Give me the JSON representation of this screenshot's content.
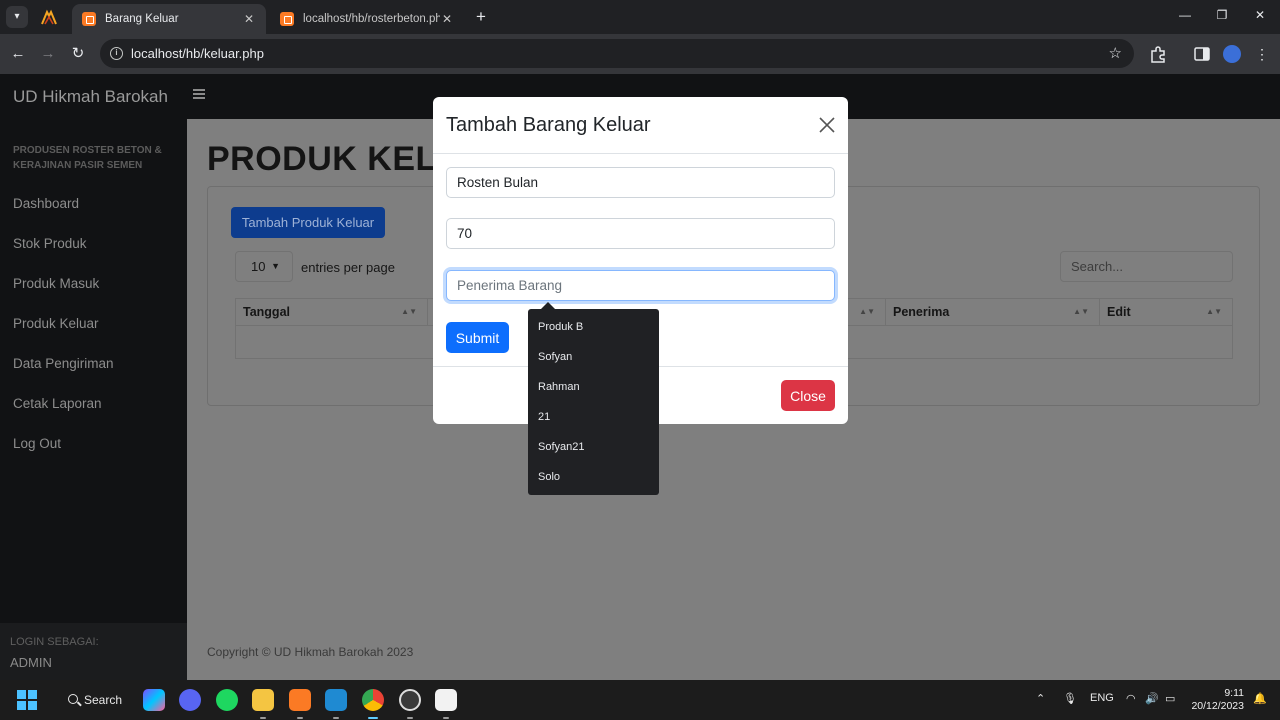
{
  "browser": {
    "tabs": [
      {
        "title": "Barang Keluar",
        "close_glyph": "✕"
      },
      {
        "title": "localhost/hb/rosterbeton.php",
        "close_glyph": "✕"
      }
    ],
    "new_tab_glyph": "+",
    "url": "localhost/hb/keluar.php",
    "window_controls": [
      "—",
      "❐",
      "✕"
    ]
  },
  "app": {
    "brand": "UD Hikmah Barokah",
    "sidebar_heading": "PRODUSEN ROSTER BETON & KERAJINAN PASIR SEMEN",
    "nav": [
      "Dashboard",
      "Stok Produk",
      "Produk Masuk",
      "Produk Keluar",
      "Data Pengiriman",
      "Cetak Laporan",
      "Log Out"
    ],
    "login_label": "LOGIN SEBAGAI:",
    "login_user": "ADMIN",
    "page_title": "PRODUK KELUAR",
    "add_button": "Tambah Produk Keluar",
    "entries_value": "10",
    "entries_label": "entries per page",
    "search_placeholder": "Search...",
    "table_headers": [
      "Tanggal",
      "Penerima",
      "Edit"
    ],
    "copyright": "Copyright © UD Hikmah Barokah 2023"
  },
  "modal": {
    "title": "Tambah Barang Keluar",
    "product_value": "Rosten Bulan",
    "qty_value": "70",
    "receiver_placeholder": "Penerima Barang",
    "submit_label": "Submit",
    "close_label": "Close"
  },
  "autocomplete": [
    "Produk B",
    "Sofyan",
    "Rahman",
    "21",
    "Sofyan21",
    "Solo"
  ],
  "taskbar": {
    "search_label": "Search",
    "language": "ENG",
    "time": "9:11",
    "date": "20/12/2023"
  },
  "colors": {
    "primary": "#0d6efd",
    "danger": "#dc3545",
    "sidebar": "#111214",
    "overlay_page": "#7f7f7f"
  }
}
